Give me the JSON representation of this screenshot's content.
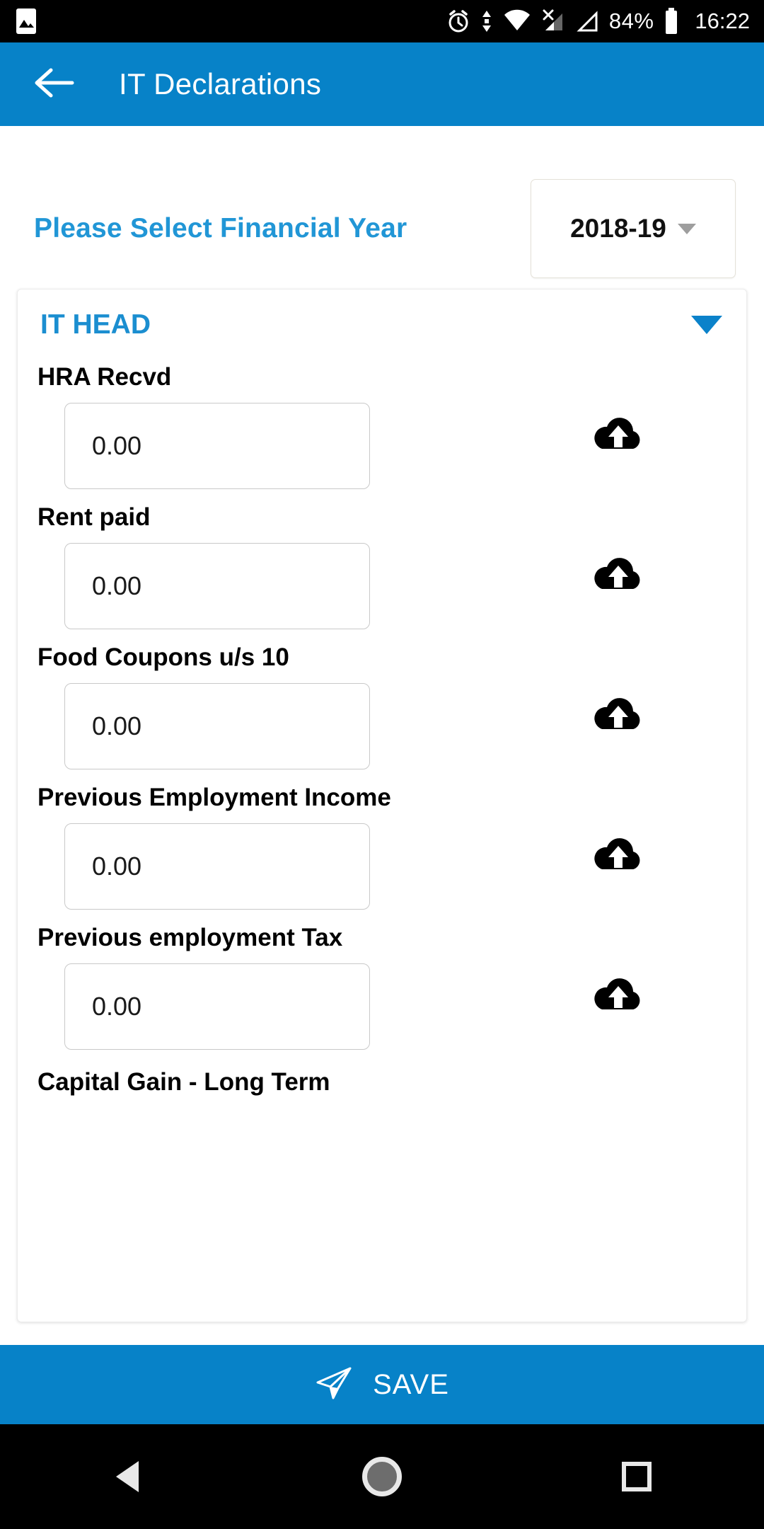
{
  "status_bar": {
    "battery_percent": "84%",
    "time": "16:22",
    "icons": [
      "image-icon",
      "alarm-icon",
      "data-transfer-icon",
      "wifi-icon",
      "sim-no-signal-icon",
      "signal-icon",
      "battery-icon"
    ]
  },
  "app_bar": {
    "back_icon": "back-arrow-icon",
    "title": "IT Declarations"
  },
  "financial_year": {
    "label": "Please Select Financial Year",
    "selected": "2018-19",
    "caret_icon": "chevron-down-icon"
  },
  "section": {
    "title": "IT HEAD",
    "collapse_icon": "chevron-down-icon",
    "fields": [
      {
        "label": "HRA Recvd",
        "value": "0.00",
        "upload_icon": "cloud-upload-icon"
      },
      {
        "label": "Rent paid",
        "value": "0.00",
        "upload_icon": "cloud-upload-icon"
      },
      {
        "label": "Food Coupons u/s 10",
        "value": "0.00",
        "upload_icon": "cloud-upload-icon"
      },
      {
        "label": "Previous Employment Income",
        "value": "0.00",
        "upload_icon": "cloud-upload-icon"
      },
      {
        "label": "Previous employment Tax",
        "value": "0.00",
        "upload_icon": "cloud-upload-icon"
      },
      {
        "label": "Capital Gain - Long Term",
        "value": "",
        "upload_icon": "cloud-upload-icon"
      }
    ]
  },
  "save_bar": {
    "label": "SAVE",
    "icon": "send-icon"
  },
  "nav_bar": {
    "back": "nav-back-icon",
    "home": "nav-home-icon",
    "recents": "nav-recents-icon"
  },
  "colors": {
    "primary": "#0782c8",
    "accent_text": "#1b8ed0",
    "label_blue": "#2196d6"
  }
}
